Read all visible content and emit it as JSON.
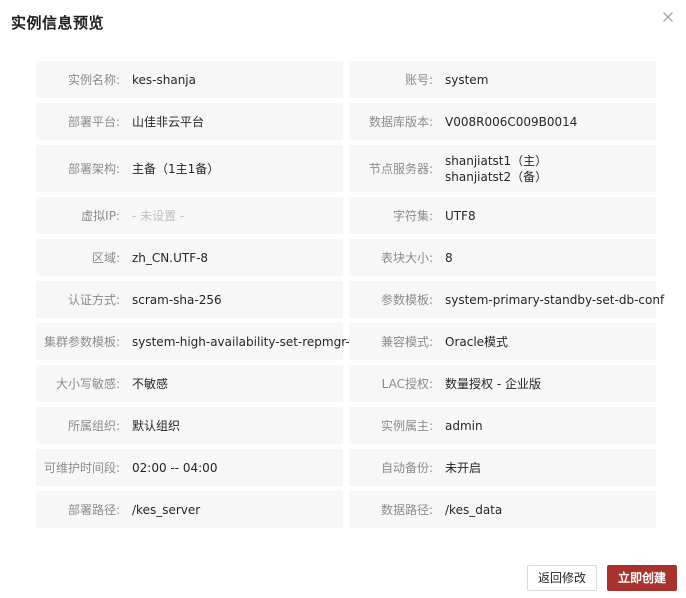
{
  "dialog": {
    "title": "实例信息预览",
    "buttons": {
      "back_label": "返回修改",
      "create_label": "立即创建"
    },
    "accent_color": "#a8322d"
  },
  "info": {
    "instance_name": {
      "label": "实例名称:",
      "value": "kes-shanja"
    },
    "account": {
      "label": "账号:",
      "value": "system"
    },
    "deploy_platform": {
      "label": "部署平台:",
      "value": "山佳非云平台"
    },
    "db_version": {
      "label": "数据库版本:",
      "value": "V008R006C009B0014"
    },
    "deploy_arch": {
      "label": "部署架构:",
      "value": "主备（1主1备）"
    },
    "node_servers": {
      "label": "节点服务器:",
      "value_1": "shanjiatst1（主）",
      "value_2": "shanjiatst2（备）"
    },
    "virtual_ip": {
      "label": "虚拟IP:",
      "value": "- 未设置 -"
    },
    "charset": {
      "label": "字符集:",
      "value": "UTF8"
    },
    "locale": {
      "label": "区域:",
      "value": "zh_CN.UTF-8"
    },
    "block_size": {
      "label": "表块大小:",
      "value": "8"
    },
    "auth_method": {
      "label": "认证方式:",
      "value": "scram-sha-256"
    },
    "param_template": {
      "label": "参数模板:",
      "value": "system-primary-standby-set-db-conf"
    },
    "cluster_param_template": {
      "label": "集群参数模板:",
      "value": "system-high-availability-set-repmgr-conf"
    },
    "compat_mode": {
      "label": "兼容模式:",
      "value": "Oracle模式"
    },
    "case_sensitive": {
      "label": "大小写敏感:",
      "value": "不敏感"
    },
    "lac_license": {
      "label": "LAC授权:",
      "value": "数量授权 - 企业版"
    },
    "organization": {
      "label": "所属组织:",
      "value": "默认组织"
    },
    "instance_owner": {
      "label": "实例属主:",
      "value": "admin"
    },
    "maintenance_window": {
      "label": "可维护时间段:",
      "value": "02:00 -- 04:00"
    },
    "auto_backup": {
      "label": "自动备份:",
      "value": "未开启"
    },
    "deploy_path": {
      "label": "部署路径:",
      "value": "/kes_server"
    },
    "data_path": {
      "label": "数据路径:",
      "value": "/kes_data"
    }
  }
}
